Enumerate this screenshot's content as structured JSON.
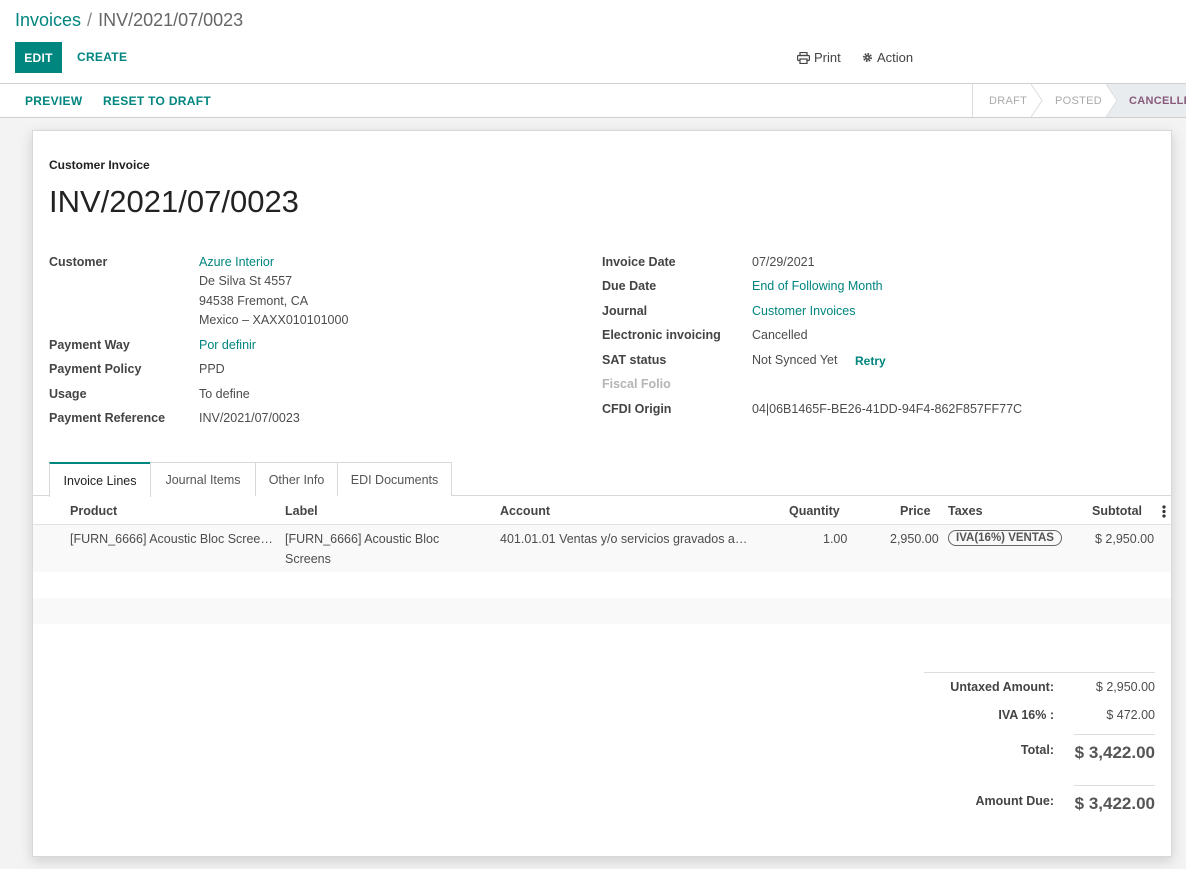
{
  "breadcrumb": {
    "parent": "Invoices",
    "separator": "/",
    "current": "INV/2021/07/0023"
  },
  "toolbar": {
    "edit_label": "EDIT",
    "create_label": "CREATE",
    "print_label": "Print",
    "action_label": "Action"
  },
  "statusbar": {
    "buttons": {
      "preview": "PREVIEW",
      "reset": "RESET TO DRAFT"
    },
    "stages": [
      "DRAFT",
      "POSTED",
      "CANCELLED"
    ],
    "active_stage": "CANCELLED"
  },
  "sheet": {
    "doc_type": "Customer Invoice",
    "name": "INV/2021/07/0023",
    "left": {
      "customer_label": "Customer",
      "customer_name": "Azure Interior",
      "address_line1": "De Silva St 4557",
      "address_line2": "94538 Fremont, CA",
      "address_line3": "Mexico – XAXX010101000",
      "payment_way_label": "Payment Way",
      "payment_way": "Por definir",
      "payment_policy_label": "Payment Policy",
      "payment_policy": "PPD",
      "usage_label": "Usage",
      "usage": "To define",
      "payment_ref_label": "Payment Reference",
      "payment_ref": "INV/2021/07/0023"
    },
    "right": {
      "invoice_date_label": "Invoice Date",
      "invoice_date": "07/29/2021",
      "due_date_label": "Due Date",
      "due_date": "End of Following Month",
      "journal_label": "Journal",
      "journal": "Customer Invoices",
      "edi_label": "Electronic invoicing",
      "edi": "Cancelled",
      "sat_label": "SAT status",
      "sat": "Not Synced Yet",
      "retry": "Retry",
      "fiscal_folio_label": "Fiscal Folio",
      "cfdi_label": "CFDI Origin",
      "cfdi": "04|06B1465F-BE26-41DD-94F4-862F857FF77C"
    }
  },
  "tabs": [
    "Invoice Lines",
    "Journal Items",
    "Other Info",
    "EDI Documents"
  ],
  "lines": {
    "columns": [
      "Product",
      "Label",
      "Account",
      "Quantity",
      "Price",
      "Taxes",
      "Subtotal"
    ],
    "rows": [
      {
        "product": "[FURN_6666] Acoustic Bloc Scree…",
        "label": "[FURN_6666] Acoustic Bloc Screens",
        "account": "401.01.01 Ventas y/o servicios gravados a…",
        "quantity": "1.00",
        "price": "2,950.00",
        "tax": "IVA(16%) VENTAS",
        "subtotal": "$ 2,950.00"
      }
    ]
  },
  "totals": {
    "untaxed_label": "Untaxed Amount:",
    "untaxed": "$ 2,950.00",
    "iva_label": "IVA 16% :",
    "iva": "$ 472.00",
    "total_label": "Total:",
    "total": "$ 3,422.00",
    "due_label": "Amount Due:",
    "due": "$ 3,422.00"
  }
}
